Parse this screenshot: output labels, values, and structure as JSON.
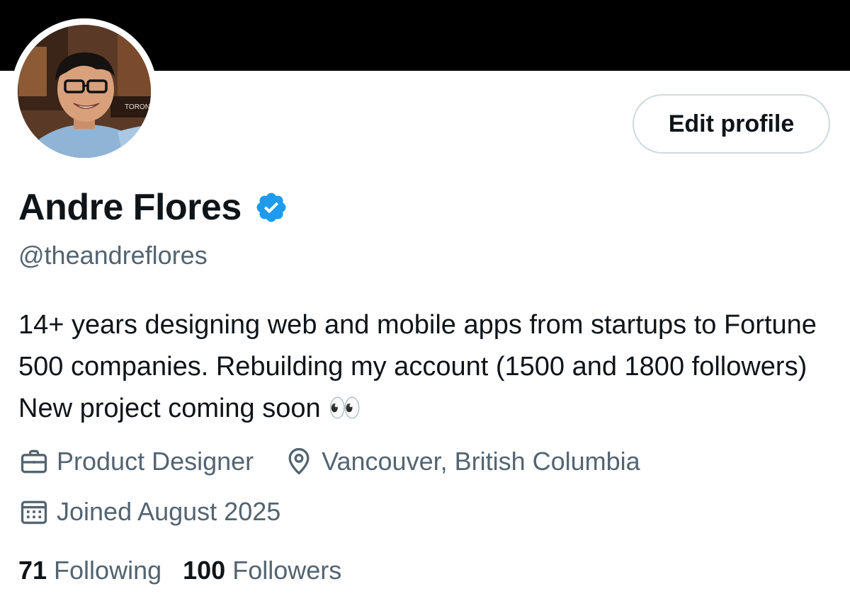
{
  "profile": {
    "display_name": "Andre Flores",
    "handle": "@theandreflores",
    "verified_icon": "verified-badge-icon",
    "bio": "14+ years designing web and mobile apps from startups to Fortune 500 companies. Rebuilding my account (1500 and 1800 followers) New project coming soon 👀",
    "edit_profile_label": "Edit profile",
    "avatar_sign_text": "TORONTO"
  },
  "meta": {
    "profession": {
      "icon": "briefcase-icon",
      "label": "Product Designer"
    },
    "location": {
      "icon": "location-pin-icon",
      "label": "Vancouver, British Columbia"
    },
    "joined": {
      "icon": "calendar-icon",
      "label": "Joined August 2025"
    }
  },
  "stats": {
    "following": {
      "count": "71",
      "label": "Following"
    },
    "followers": {
      "count": "100",
      "label": "Followers"
    }
  },
  "colors": {
    "banner": "#000000",
    "text_primary": "#0f1419",
    "text_secondary": "#536471",
    "verified_blue": "#1d9bf0",
    "button_border": "#cfd9de"
  }
}
